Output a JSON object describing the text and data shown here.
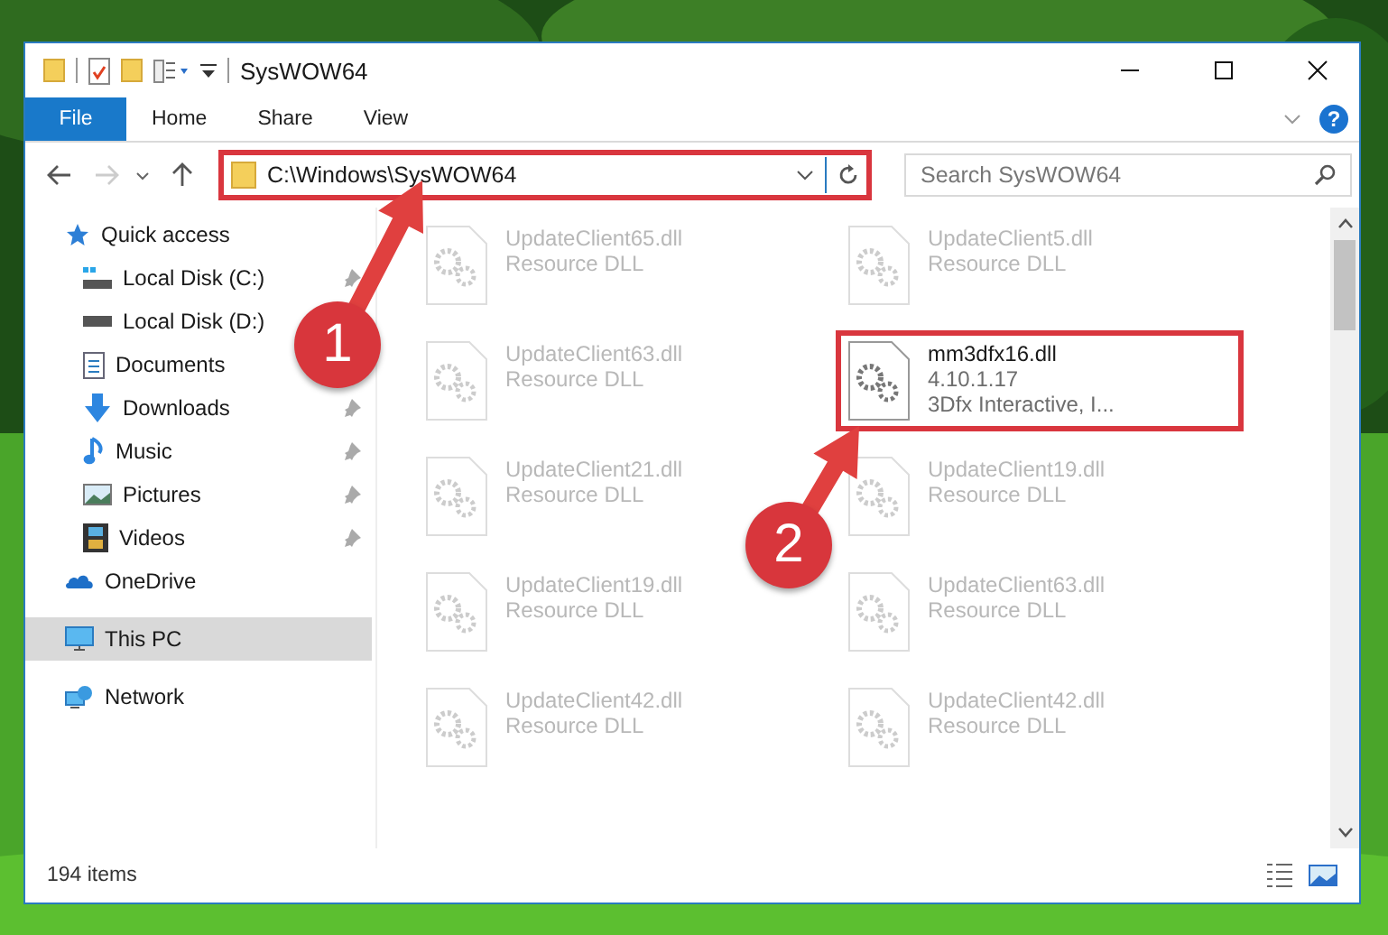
{
  "window": {
    "title": "SysWOW64"
  },
  "ribbon": {
    "tabs": [
      {
        "label": "File",
        "kind": "file",
        "selected": false
      },
      {
        "label": "Home",
        "kind": "tab",
        "selected": false
      },
      {
        "label": "Share",
        "kind": "tab",
        "selected": false
      },
      {
        "label": "View",
        "kind": "tab",
        "selected": false
      }
    ],
    "help": "?"
  },
  "navigation": {
    "forward_disabled": true
  },
  "address": {
    "path": "C:\\Windows\\SysWOW64",
    "highlighted": true
  },
  "search": {
    "placeholder": "Search SysWOW64"
  },
  "sidebar": {
    "items": [
      {
        "label": "Quick access",
        "selected": false,
        "children": [
          {
            "label": "Local Disk (C:)",
            "selected": false,
            "pinned": true
          },
          {
            "label": "Local Disk (D:)",
            "selected": false
          },
          {
            "label": "Documents",
            "selected": false
          },
          {
            "label": "Downloads",
            "selected": false,
            "pinned": true
          },
          {
            "label": "Music",
            "selected": false,
            "pinned": true
          },
          {
            "label": "Pictures",
            "selected": false,
            "pinned": true
          },
          {
            "label": "Videos",
            "selected": false,
            "pinned": true
          }
        ]
      },
      {
        "label": "OneDrive",
        "selected": false
      },
      {
        "label": "This PC",
        "selected": true
      },
      {
        "label": "Network",
        "selected": false
      }
    ]
  },
  "files": [
    {
      "name": "UpdateClient65.dll",
      "details": [
        "Resource DLL"
      ],
      "blurred": true,
      "highlighted": false
    },
    {
      "name": "UpdateClient5.dll",
      "details": [
        "Resource DLL"
      ],
      "blurred": true,
      "highlighted": false
    },
    {
      "name": "UpdateClient63.dll",
      "details": [
        "Resource DLL"
      ],
      "blurred": true,
      "highlighted": false
    },
    {
      "name": "mm3dfx16.dll",
      "details": [
        "4.10.1.17",
        "3Dfx Interactive, I..."
      ],
      "blurred": false,
      "highlighted": true
    },
    {
      "name": "UpdateClient21.dll",
      "details": [
        "Resource DLL"
      ],
      "blurred": true,
      "highlighted": false
    },
    {
      "name": "UpdateClient19.dll",
      "details": [
        "Resource DLL"
      ],
      "blurred": true,
      "highlighted": false
    },
    {
      "name": "UpdateClient19.dll",
      "details": [
        "Resource DLL"
      ],
      "blurred": true,
      "highlighted": false
    },
    {
      "name": "UpdateClient63.dll",
      "details": [
        "Resource DLL"
      ],
      "blurred": true,
      "highlighted": false
    },
    {
      "name": "UpdateClient42.dll",
      "details": [
        "Resource DLL"
      ],
      "blurred": true,
      "highlighted": false
    },
    {
      "name": "UpdateClient42.dll",
      "details": [
        "Resource DLL"
      ],
      "blurred": true,
      "highlighted": false
    }
  ],
  "status_bar": {
    "item_count": "194 items"
  },
  "callouts": [
    {
      "label": "1"
    },
    {
      "label": "2"
    }
  ]
}
